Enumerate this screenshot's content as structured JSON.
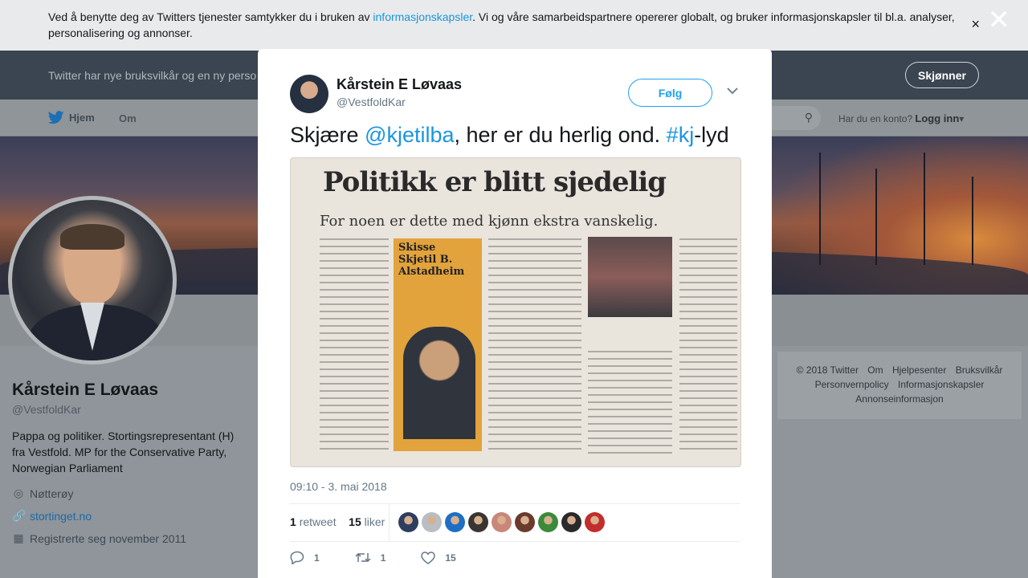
{
  "cookie": {
    "text_before": "Ved å benytte deg av Twitters tjenester samtykker du i bruken av ",
    "link": "informasjonskapsler",
    "text_after": ". Vi og våre samarbeidspartnere opererer globalt, og bruker informasjonskapsler til bl.a. analyser, personalisering og annonser.",
    "close_small": "×",
    "close_big": "✕"
  },
  "tos": {
    "text": "Twitter har nye bruksvilkår og en ny perso",
    "button": "Skjønner"
  },
  "nav": {
    "home": "Hjem",
    "about": "Om",
    "login_prompt": "Har du en konto?",
    "login": "Logg inn",
    "login_caret": "▾"
  },
  "profile": {
    "name": "Kårstein E Løvaas",
    "handle": "@VestfoldKar",
    "bio": "Pappa og politiker. Stortingsrepresentant (H) fra Vestfold. MP for the Conservative Party, Norwegian Parliament",
    "location": "Nøtterøy",
    "website": "stortinget.no",
    "joined": "Registrerte seg november 2011"
  },
  "footer": {
    "items": [
      "© 2018 Twitter",
      "Om",
      "Hjelpesenter",
      "Bruksvilkår",
      "Personvernpolicy",
      "Informasjonskapsler",
      "Annonseinformasjon"
    ]
  },
  "tweet": {
    "author_name": "Kårstein E Løvaas",
    "author_handle": "@VestfoldKar",
    "follow": "Følg",
    "caret": "⌄",
    "text_1": "Skjære ",
    "mention": "@kjetilba",
    "text_2": ", her er du herlig ond. ",
    "hashtag": "#kj",
    "text_3": "-lyd",
    "photo_headline": "Politikk er blitt sjedelig",
    "photo_subhead": "For noen er dette med kjønn ekstra vanskelig.",
    "photo_kicker": "Skisse",
    "photo_byline": "Skjetil B. Alstadheim",
    "time": "09:10 - 3. mai 2018",
    "retweets": "1",
    "retweets_label": "retweet",
    "likes": "15",
    "likes_label": "liker",
    "replies_count": "1",
    "retweet_count": "1",
    "like_count": "15"
  },
  "likers": {
    "colors": [
      "#2d3e5e",
      "#b8bec4",
      "#1e6fc4",
      "#3a3530",
      "#c9877a",
      "#6b3a2f",
      "#3b8a3a",
      "#2a2a2a",
      "#c22d2d"
    ]
  },
  "icons": {
    "twitter_bird": "bird-icon",
    "search": "search-icon",
    "location": "location-pin-icon",
    "link": "link-icon",
    "calendar": "calendar-icon",
    "reply": "reply-icon",
    "retweet": "retweet-icon",
    "like": "heart-icon"
  }
}
